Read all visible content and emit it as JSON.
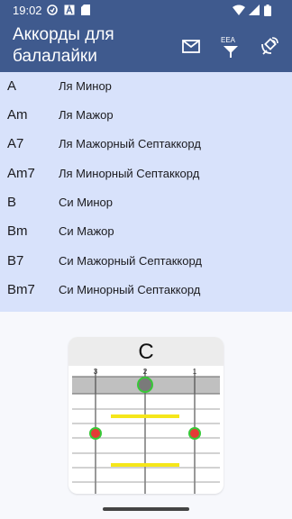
{
  "status_bar": {
    "time": "19:02",
    "icons": [
      "sync-icon",
      "font-icon",
      "sd-card-icon",
      "wifi-icon",
      "signal-icon",
      "battery-icon"
    ]
  },
  "app_bar": {
    "title": "Аккорды для балалайки",
    "eea_label": "EEA",
    "actions": [
      "mail-icon",
      "eea-filter-icon",
      "satellite-icon"
    ]
  },
  "chords": [
    {
      "code": "A",
      "name": "Ля Минор"
    },
    {
      "code": "Am",
      "name": "Ля Мажор"
    },
    {
      "code": "A7",
      "name": "Ля Мажорный Септаккорд"
    },
    {
      "code": "Am7",
      "name": "Ля Минорный Септаккорд"
    },
    {
      "code": "B",
      "name": "Си Минор"
    },
    {
      "code": "Bm",
      "name": "Си Мажор"
    },
    {
      "code": "B7",
      "name": "Си Мажорный Септаккорд"
    },
    {
      "code": "Bm7",
      "name": "Си Минорный Септаккорд"
    }
  ],
  "chord_card": {
    "chord": "C",
    "string_labels": [
      "3",
      "2",
      "1"
    ],
    "colors": {
      "nut": "#c0c0c0",
      "open_dot": "#7a7a7a",
      "fret_dot": "#e53935",
      "dot_ring": "#37c837",
      "marker": "#f5e61a"
    }
  }
}
